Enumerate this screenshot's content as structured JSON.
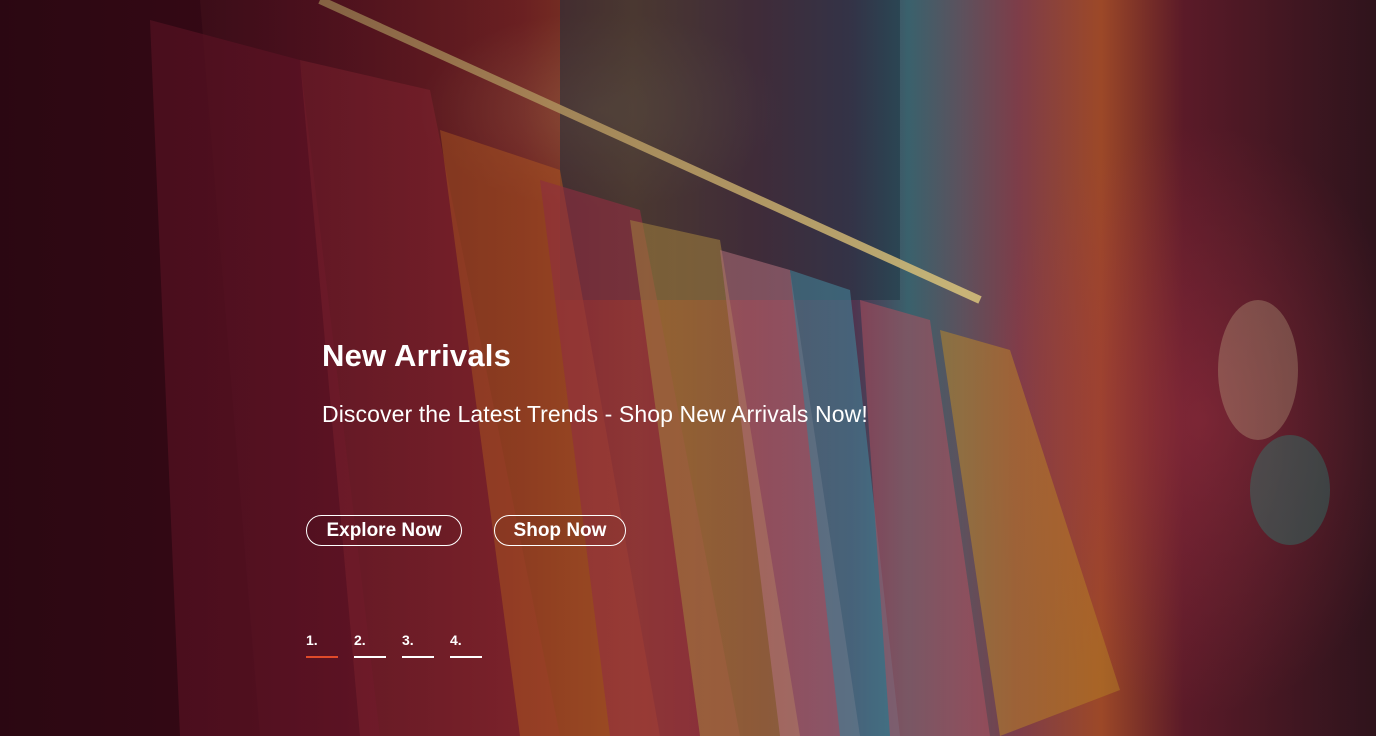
{
  "hero": {
    "title": "New Arrivals",
    "subtitle": "Discover the Latest Trends - Shop New Arrivals Now!",
    "background_image": "clothing-rack-photo",
    "buttons": {
      "explore_label": "Explore Now",
      "shop_label": "Shop Now"
    },
    "pagination": [
      {
        "label": "1.",
        "active": true
      },
      {
        "label": "2.",
        "active": false
      },
      {
        "label": "3.",
        "active": false
      },
      {
        "label": "4.",
        "active": false
      }
    ]
  },
  "colors": {
    "text": "#ffffff",
    "active_indicator": "#e04a2a",
    "inactive_indicator": "#ffffff"
  }
}
